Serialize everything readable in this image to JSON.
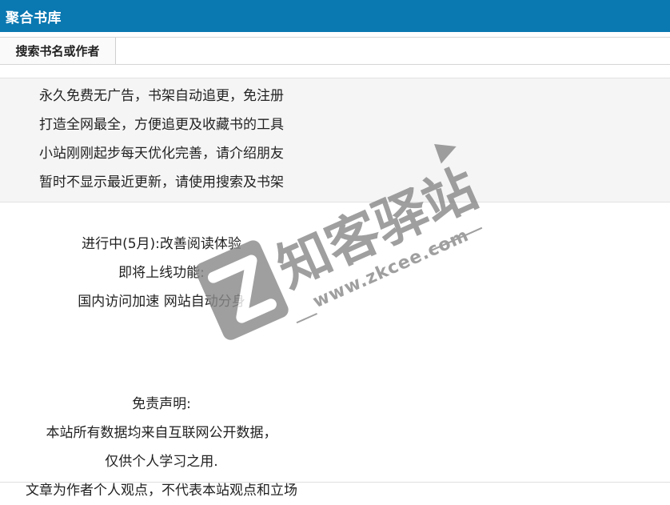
{
  "header": {
    "title": "聚合书库"
  },
  "search": {
    "label": "搜索书名或作者",
    "value": "",
    "placeholder": ""
  },
  "notice": {
    "lines": [
      "永久免费无广告，书架自动追更，免注册",
      "打造全网最全，方便追更及收藏书的工具",
      "小站刚刚起步每天优化完善，请介绍朋友",
      "暂时不显示最近更新，请使用搜索及书架"
    ]
  },
  "roadmap": {
    "in_progress": "进行中(5月):改善阅读体验",
    "upcoming_title": "即将上线功能:",
    "upcoming_items": "国内访问加速 网站自动分身"
  },
  "disclaimer": {
    "title": "免责声明:",
    "lines": [
      "本站所有数据均来自互联网公开数据，",
      "仅供个人学习之用.",
      "文章为作者个人观点，不代表本站观点和立场"
    ]
  },
  "watermark": {
    "text": "知客驿站",
    "url": "www.zkcee.com",
    "color": "#8a8a8a"
  },
  "colors": {
    "header_bg": "#0a78b1",
    "panel_bg": "#f5f5f5"
  }
}
